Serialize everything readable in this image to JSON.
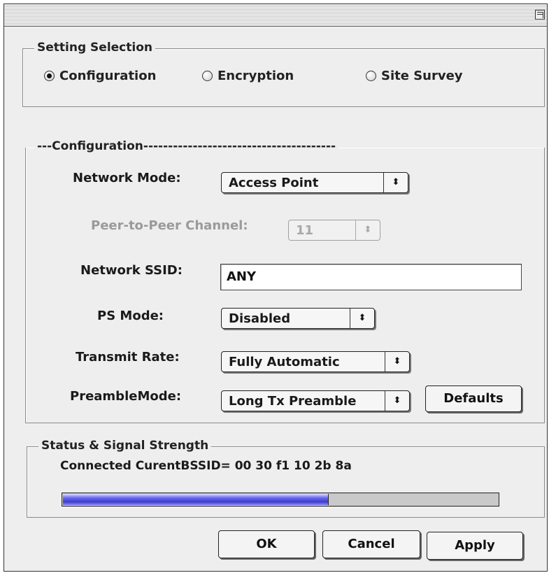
{
  "setting_selection": {
    "legend": "Setting Selection",
    "options": [
      {
        "label": "Configuration",
        "selected": true
      },
      {
        "label": "Encryption",
        "selected": false
      },
      {
        "label": "Site Survey",
        "selected": false
      }
    ]
  },
  "configuration": {
    "legend": "---Configuration---------------------------------------",
    "network_mode": {
      "label": "Network Mode:",
      "value": "Access Point"
    },
    "peer_channel": {
      "label": "Peer-to-Peer Channel:",
      "value": "11",
      "disabled": true
    },
    "network_ssid": {
      "label": "Network SSID:",
      "value": "ANY"
    },
    "ps_mode": {
      "label": "PS Mode:",
      "value": "Disabled"
    },
    "transmit_rate": {
      "label": "Transmit Rate:",
      "value": "Fully Automatic"
    },
    "preamble_mode": {
      "label": "PreambleMode:",
      "value": "Long Tx Preamble"
    },
    "defaults_label": "Defaults"
  },
  "status": {
    "legend": "Status & Signal Strength",
    "text": "Connected  CurentBSSID= 00 30 f1 10 2b 8a",
    "signal_strength_fraction": 0.61
  },
  "buttons": {
    "ok": "OK",
    "cancel": "Cancel",
    "apply": "Apply"
  },
  "icons": {
    "popup_arrows": "⬍"
  },
  "colors": {
    "signal_fill": "#3c3ccc",
    "window_bg": "#eeeeee"
  }
}
